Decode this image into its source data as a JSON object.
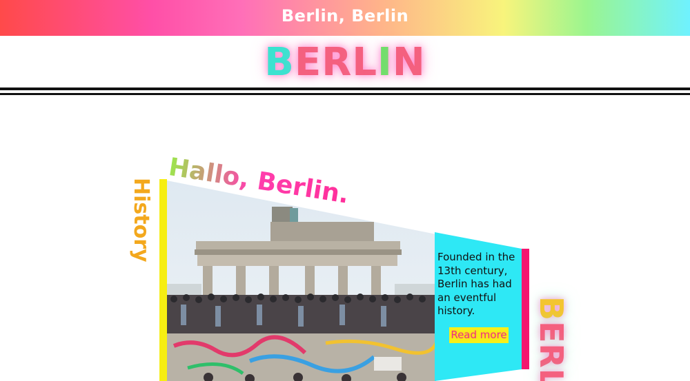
{
  "header": {
    "title": "Berlin, Berlin"
  },
  "logo": {
    "letters": [
      "B",
      "E",
      "R",
      "L",
      "I",
      "N"
    ]
  },
  "hero": {
    "heading": "Hallo, Berlin.",
    "section_label": "History",
    "photo_alt": "Brandenburg Gate with crowd on the Berlin Wall",
    "description": "Founded in the 13th century, Berlin has had an eventful history.",
    "read_more_label": "Read more"
  },
  "side_logo": {
    "letters": [
      "B",
      "E",
      "R",
      "L"
    ]
  },
  "colors": {
    "accent_pink": "#f4166f",
    "accent_yellow": "#f6ee12",
    "accent_cyan": "#2ee8f5",
    "accent_orange": "#f3a81d"
  }
}
